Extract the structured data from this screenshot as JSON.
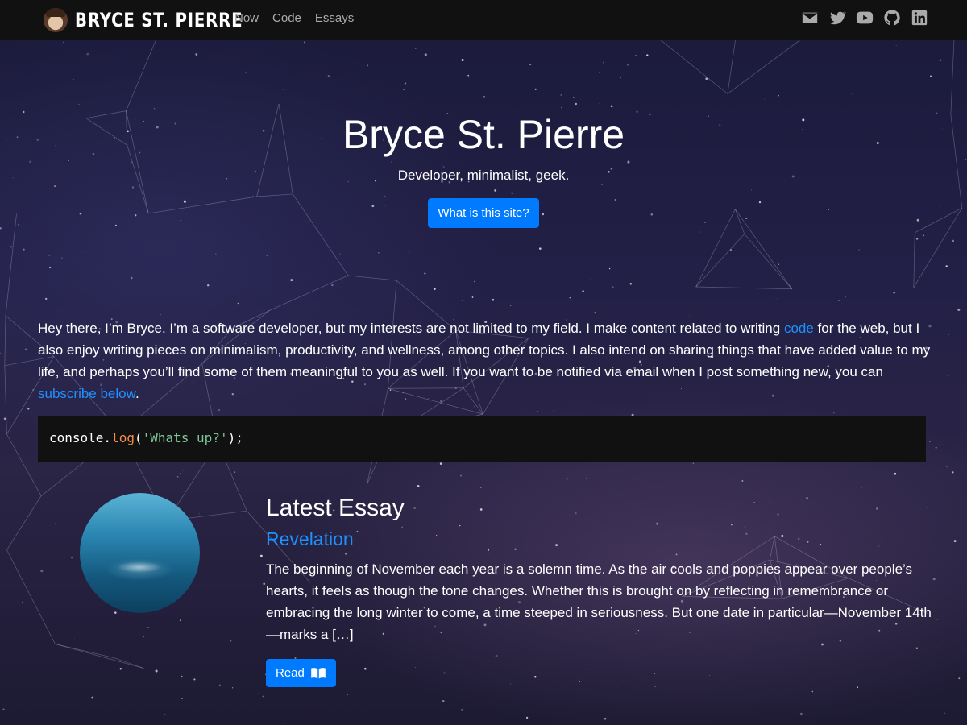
{
  "nav": {
    "brand": "BRYCE ST. PIERRE",
    "links": [
      "Now",
      "Code",
      "Essays"
    ],
    "social": [
      "envelope-icon",
      "twitter-icon",
      "youtube-icon",
      "github-icon",
      "linkedin-icon"
    ]
  },
  "hero": {
    "title": "Bryce St. Pierre",
    "tagline": "Developer, minimalist, geek.",
    "button": "What is this site?"
  },
  "intro": {
    "text_1": "Hey there, I’m Bryce. I’m a software developer, but my interests are not limited to my field. I make content related to writing ",
    "link_1": "code",
    "text_2": " for the web, but I also enjoy writing pieces on minimalism, productivity, and wellness, among other topics. I also intend on sharing things that have added value to my life, and perhaps you’ll find some of them meaningful to you as well. If you want to be notified via email when I post something new, you can ",
    "link_2": "subscribe below",
    "text_3": "."
  },
  "code": {
    "obj": "console.",
    "fn": "log",
    "open": "(",
    "str": "'Whats up?'",
    "close": ");"
  },
  "essay": {
    "heading": "Latest Essay",
    "title": "Revelation",
    "excerpt": "The beginning of November each year is a solemn time. As the air cools and poppies appear over people’s hearts, it feels as though the tone changes. Whether this is brought on by reflecting in remembrance or embracing the long winter to come, a time steeped in seriousness. But one date in particular—November 14th—marks a […]",
    "button": "Read"
  },
  "colors": {
    "accent": "#007bff",
    "link": "#1e90ff",
    "navbar": "#111111"
  }
}
